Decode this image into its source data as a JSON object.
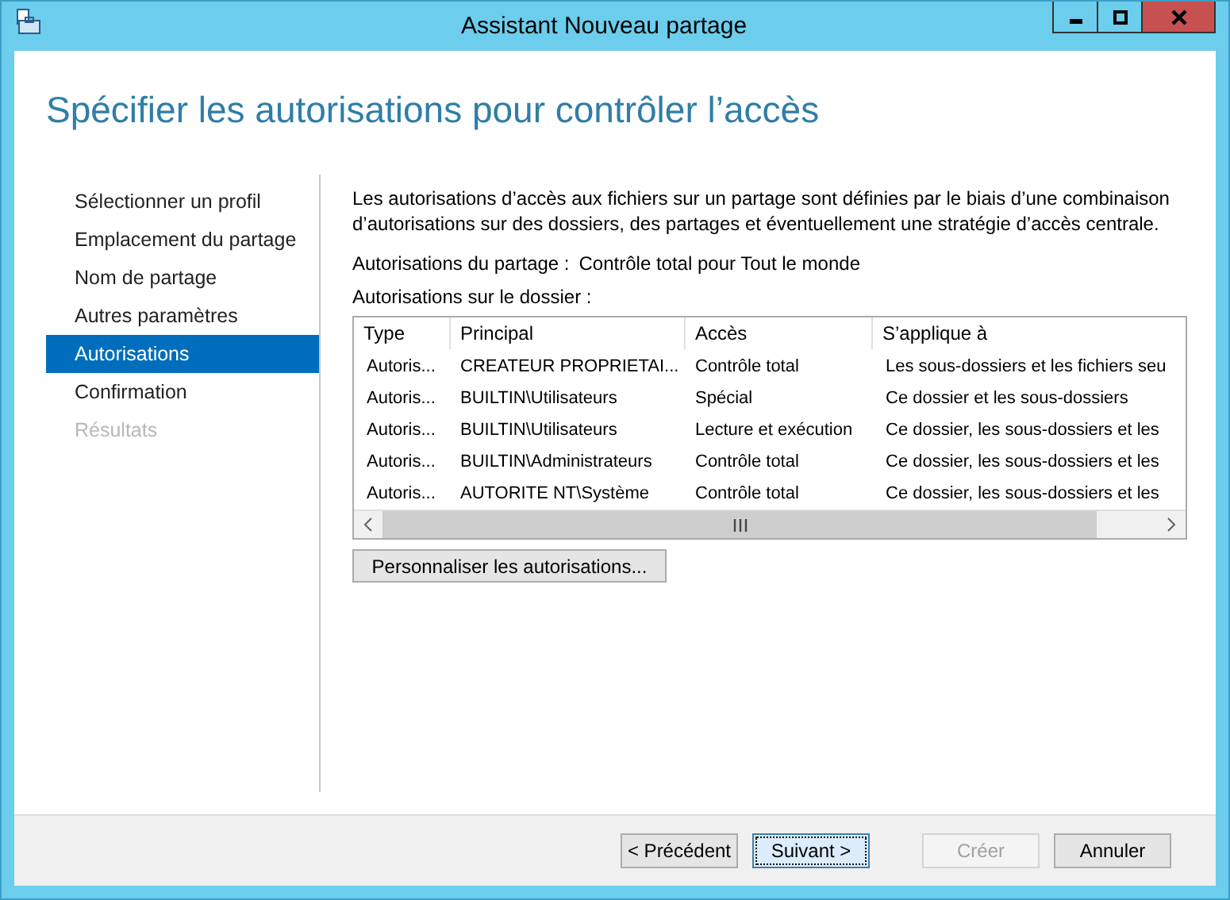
{
  "window": {
    "title": "Assistant Nouveau partage"
  },
  "page_title": "Spécifier les autorisations pour contrôler l’accès",
  "sidebar": {
    "items": [
      {
        "label": "Sélectionner un profil",
        "selected": false,
        "disabled": false
      },
      {
        "label": "Emplacement du partage",
        "selected": false,
        "disabled": false
      },
      {
        "label": "Nom de partage",
        "selected": false,
        "disabled": false
      },
      {
        "label": "Autres paramètres",
        "selected": false,
        "disabled": false
      },
      {
        "label": "Autorisations",
        "selected": true,
        "disabled": false
      },
      {
        "label": "Confirmation",
        "selected": false,
        "disabled": false
      },
      {
        "label": "Résultats",
        "selected": false,
        "disabled": true
      }
    ]
  },
  "description": "Les autorisations d’accès aux fichiers sur un partage sont définies par le biais d’une combinaison d’autorisations sur des dossiers, des partages et éventuellement une stratégie d’accès centrale.",
  "share_permissions": {
    "label": "Autorisations du partage :",
    "value": "Contrôle total pour Tout le monde"
  },
  "folder_permissions_label": "Autorisations sur le dossier :",
  "table": {
    "columns": [
      "Type",
      "Principal",
      "Accès",
      "S’applique à"
    ],
    "rows": [
      [
        "Autoris...",
        "CREATEUR PROPRIETAI...",
        "Contrôle total",
        "Les sous-dossiers et les fichiers seu"
      ],
      [
        "Autoris...",
        "BUILTIN\\Utilisateurs",
        "Spécial",
        "Ce dossier et les sous-dossiers"
      ],
      [
        "Autoris...",
        "BUILTIN\\Utilisateurs",
        "Lecture et exécution",
        "Ce dossier, les sous-dossiers et les"
      ],
      [
        "Autoris...",
        "BUILTIN\\Administrateurs",
        "Contrôle total",
        "Ce dossier, les sous-dossiers et les"
      ],
      [
        "Autoris...",
        "AUTORITE NT\\Système",
        "Contrôle total",
        "Ce dossier, les sous-dossiers et les"
      ]
    ]
  },
  "customize_button": "Personnaliser les autorisations...",
  "footer_buttons": [
    {
      "label": "< Précédent",
      "disabled": false,
      "focused": false
    },
    {
      "label": "Suivant >",
      "disabled": false,
      "focused": true
    },
    {
      "label": "Créer",
      "disabled": true,
      "focused": false
    },
    {
      "label": "Annuler",
      "disabled": false,
      "focused": false
    }
  ]
}
